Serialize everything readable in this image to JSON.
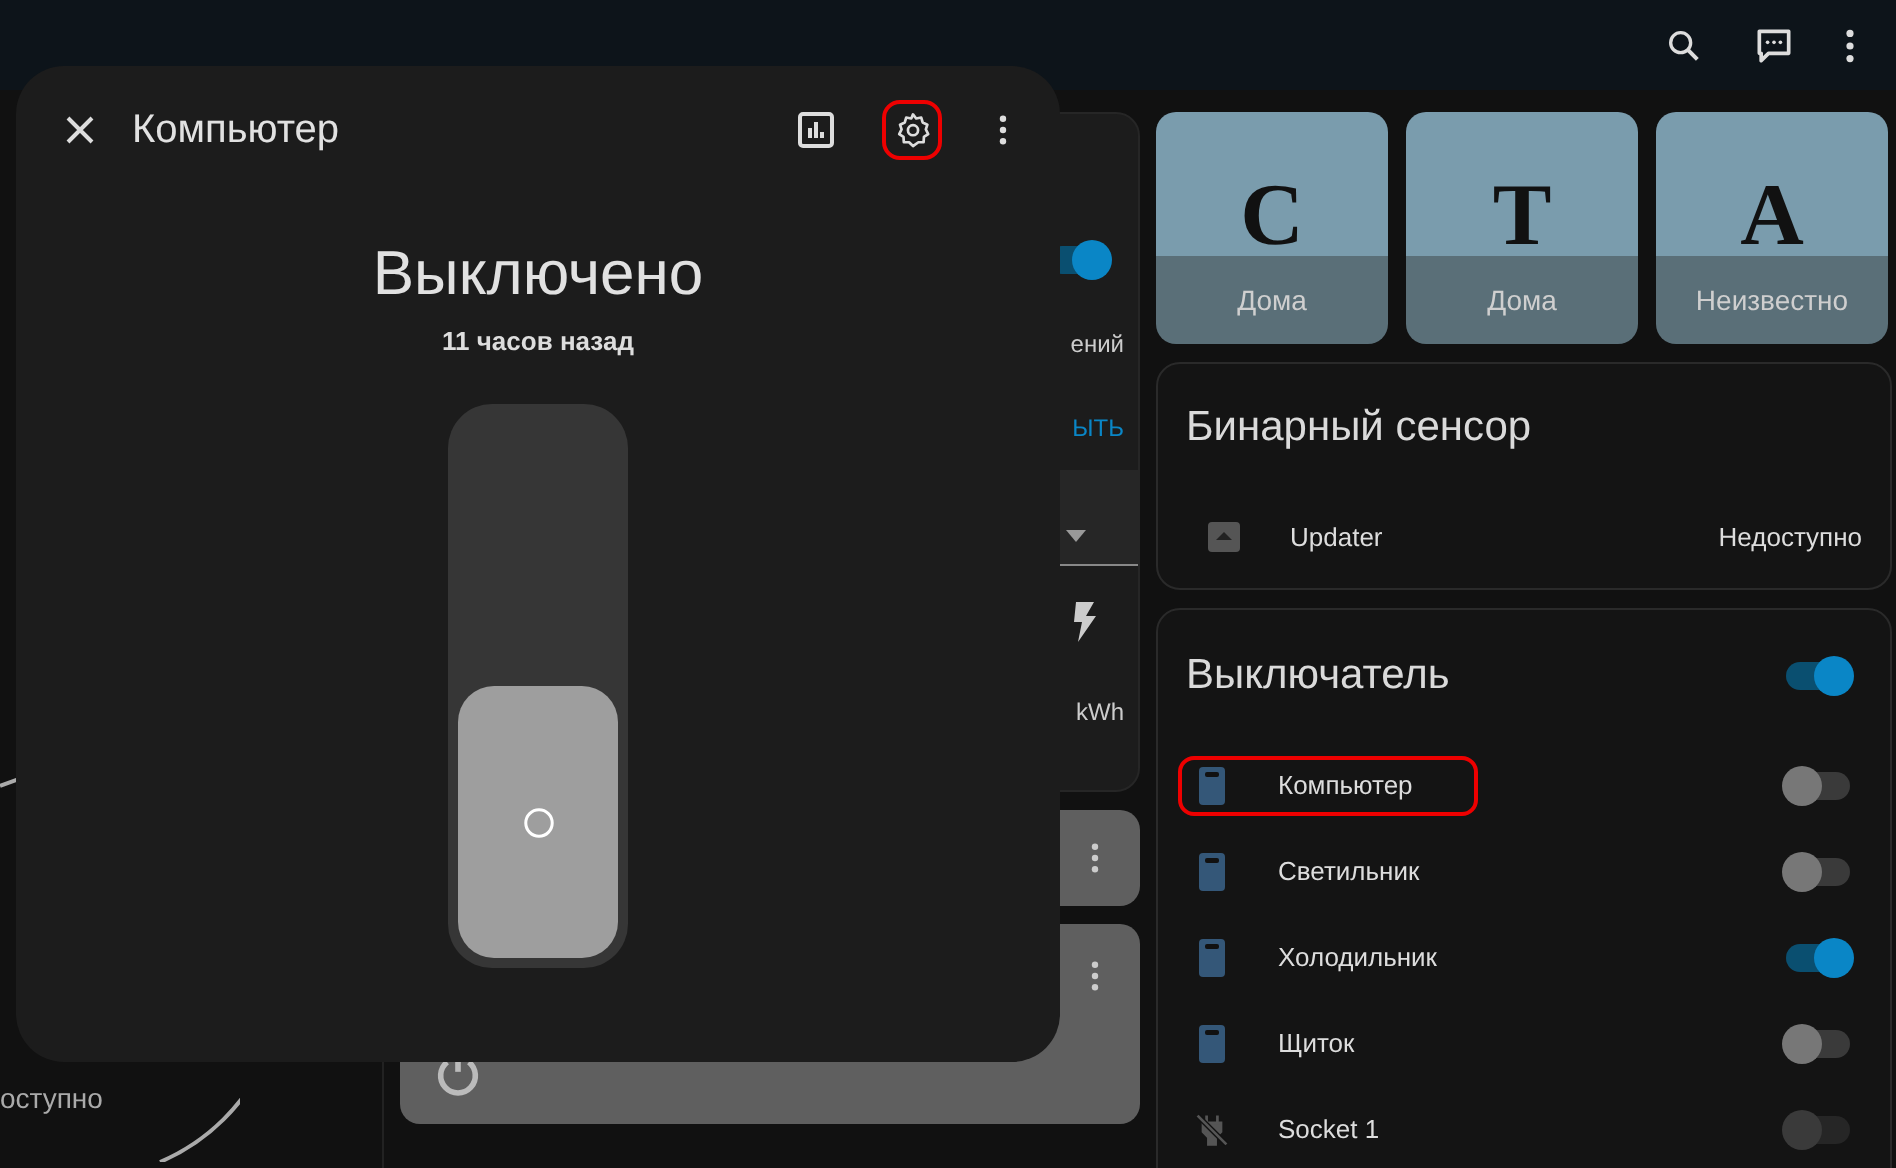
{
  "background": {
    "left_card": {
      "status": "оступно"
    },
    "middle_card": {
      "on": true,
      "text": "ений",
      "link": "ЫТЬ",
      "unit": "kWh"
    }
  },
  "person_tiles": [
    {
      "initial": "С",
      "state": "Дома"
    },
    {
      "initial": "Т",
      "state": "Дома"
    },
    {
      "initial": "А",
      "state": "Неизвестно"
    }
  ],
  "binary_sensor_card": {
    "title": "Бинарный сенсор",
    "rows": [
      {
        "name": "Updater",
        "state": "Недоступно"
      }
    ]
  },
  "switch_card": {
    "title": "Выключатель",
    "on": true,
    "rows": [
      {
        "name": "Компьютер",
        "on": false,
        "available": true,
        "highlighted": true
      },
      {
        "name": "Светильник",
        "on": false,
        "available": true,
        "highlighted": false
      },
      {
        "name": "Холодильник",
        "on": true,
        "available": true,
        "highlighted": false
      },
      {
        "name": "Щиток",
        "on": false,
        "available": true,
        "highlighted": false
      },
      {
        "name": "Socket 1",
        "on": false,
        "available": false,
        "highlighted": false
      }
    ]
  },
  "dialog": {
    "title": "Компьютер",
    "state": "Выключено",
    "last_changed": "11 часов назад",
    "on": false,
    "settings_highlighted": true
  }
}
